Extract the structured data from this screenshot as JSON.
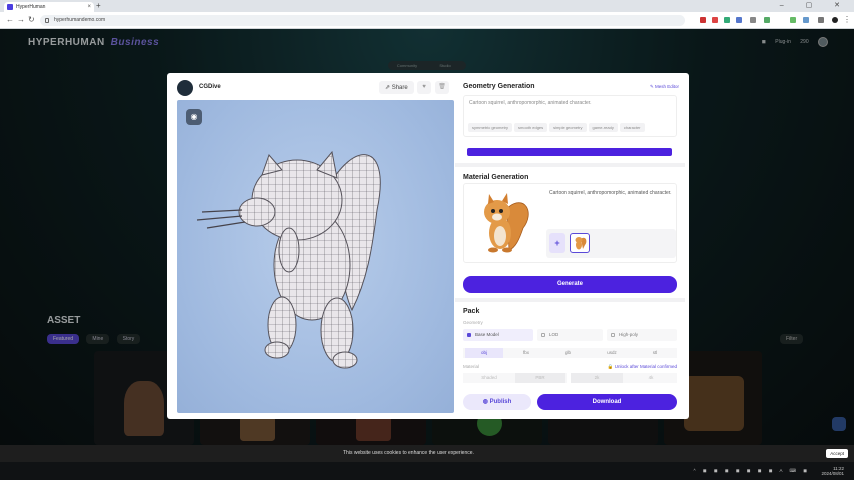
{
  "browser": {
    "tab_title": "HyperHuman",
    "url": "hyperhumandemo.com",
    "new_tab": "+",
    "window_controls": "–  ▢  ✕"
  },
  "header": {
    "brand": "HYPERHUMAN",
    "brand_suffix": "Business",
    "plugin": "Plug-in",
    "credits": "290"
  },
  "toggle": [
    "Community",
    "Studio"
  ],
  "asset_section": {
    "title": "ASSET",
    "chips": [
      "Featured",
      "Mine",
      "Story"
    ],
    "filter": "Filter"
  },
  "modal": {
    "author": "CGDive",
    "share": "Share",
    "geometry": {
      "title": "Geometry Generation",
      "mesh_editor": "Mesh Editor",
      "prompt": "Cartoon squirrel, anthropomorphic, animated character.",
      "tags": [
        "symmetric geometry",
        "smooth edges",
        "simple geometry",
        "game-ready",
        "character"
      ]
    },
    "material": {
      "title": "Material Generation",
      "prompt": "Cartoon squirrel, anthropomorphic, animated character.",
      "generate": "Generate"
    },
    "pack": {
      "title": "Pack",
      "geometry_label": "Geometry",
      "geometry_options": [
        "Base Model",
        "LOD",
        "High-poly"
      ],
      "formats": [
        "obj",
        "fbx",
        "glb",
        "usdz",
        "stl"
      ],
      "material_label": "Material",
      "unlock_note": "Unlock after Material confirmed",
      "material_options": [
        "Shaded",
        "PBR",
        "2k",
        "4k"
      ],
      "publish": "Publish",
      "download": "Download"
    }
  },
  "cookie": {
    "message": "This website uses cookies to enhance the user experience.",
    "accept": "Accept"
  },
  "taskbar": {
    "time": "11:22",
    "date": "2024/08/01"
  },
  "colors": {
    "accent": "#4c22df",
    "brand_suffix": "#8b7ff0"
  }
}
